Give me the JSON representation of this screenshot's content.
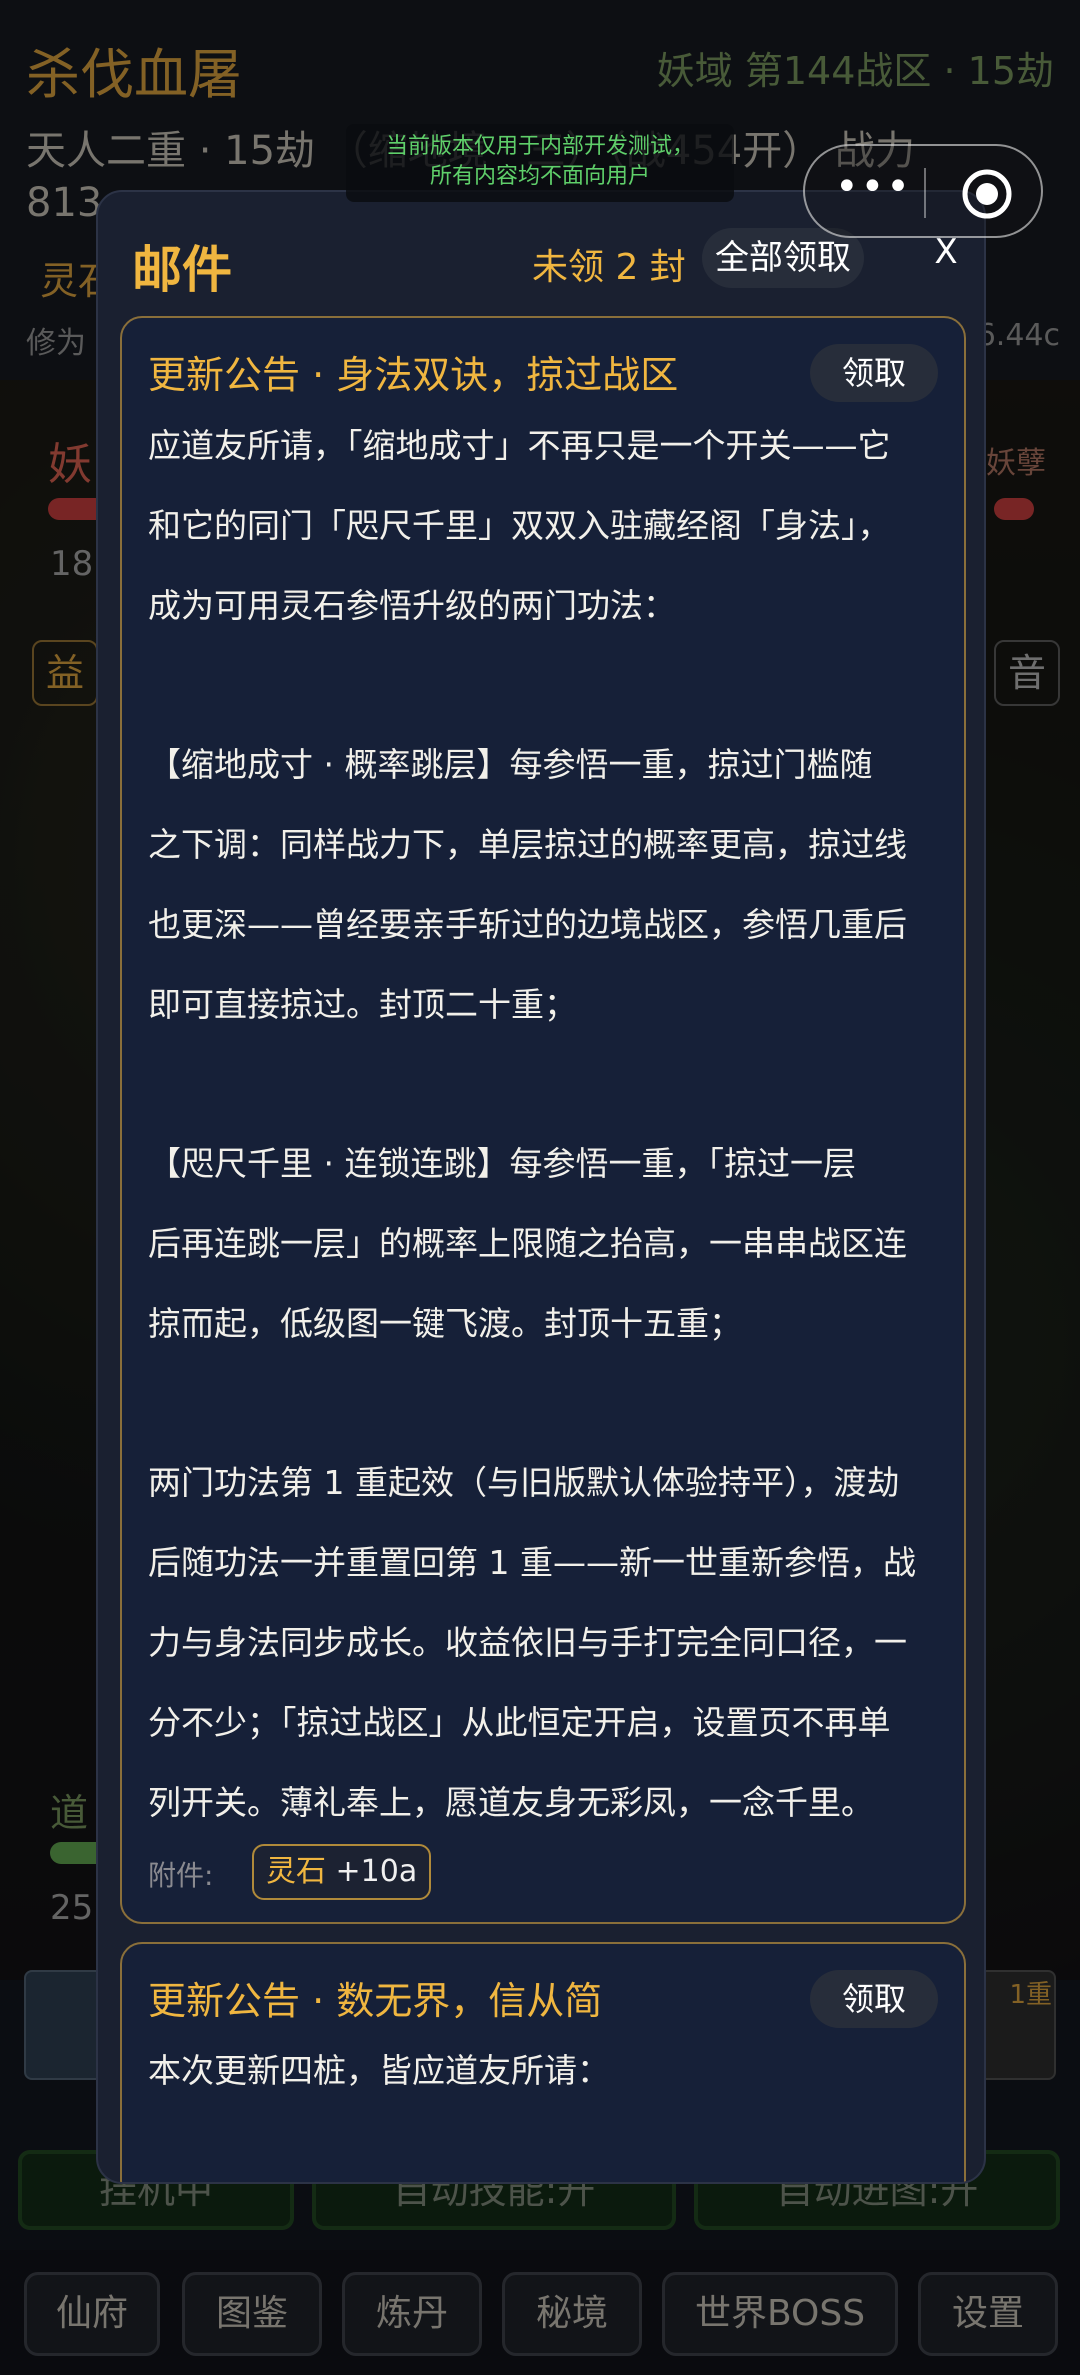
{
  "background": {
    "game_title": "杀伐血屠",
    "zone_info": "妖域 第144战区 · 15劫",
    "realm_line": "天人二重 · 15劫 （缩地境 · 三）（战454开） 战力",
    "realm_line2": "813",
    "lingshi_tag": "灵石",
    "xiuwei_label": "修为",
    "speed_value": "6.44c",
    "enemy_name": "妖",
    "enemy_right": "妖孽",
    "num_18": "18",
    "tag_yi": "益",
    "tag_yin": "音",
    "dao_label": "道",
    "num_25": "25",
    "level_badge": "1重",
    "controls": [
      "挂机中",
      "自动技能:开",
      "自动进图:开"
    ],
    "nav": [
      "仙府",
      "图鉴",
      "炼丹",
      "秘境",
      "世界BOSS",
      "设置"
    ]
  },
  "dev_notice": {
    "line1": "当前版本仅用于内部开发测试，",
    "line2": "所有内容均不面向用户"
  },
  "capsule": {
    "more_icon": "more-dots-icon",
    "target_icon": "target-icon"
  },
  "mail_modal": {
    "title": "邮件",
    "unclaimed": "未领 2 封",
    "claim_all": "全部领取",
    "close": "X",
    "mails": [
      {
        "title": "更新公告 · 身法双诀，掠过战区",
        "claim": "领取",
        "body": [
          "应道友所请，「缩地成寸」不再只是一个开关——它",
          "和它的同门「咫尺千里」双双入驻藏经阁「身法」，",
          "成为可用灵石参悟升级的两门功法：",
          "",
          "【缩地成寸 · 概率跳层】每参悟一重，掠过门槛随",
          "之下调：同样战力下，单层掠过的概率更高，掠过线",
          "也更深——曾经要亲手斩过的边境战区，参悟几重后",
          "即可直接掠过。封顶二十重；",
          "",
          "【咫尺千里 · 连锁连跳】每参悟一重，「掠过一层",
          "后再连跳一层」的概率上限随之抬高，一串串战区连",
          "掠而起，低级图一键飞渡。封顶十五重；",
          "",
          "两门功法第 1 重起效（与旧版默认体验持平），渡劫",
          "后随功法一并重置回第 1 重——新一世重新参悟，战",
          "力与身法同步成长。收益依旧与手打完全同口径，一",
          "分不少；「掠过战区」从此恒定开启，设置页不再单",
          "列开关。薄礼奉上，愿道友身无彩凤，一念千里。"
        ],
        "attachment_label": "附件:",
        "attachment_resource": "灵石",
        "attachment_amount": "+10a"
      },
      {
        "title": "更新公告 · 数无界，信从简",
        "claim": "领取",
        "body_first": "本次更新四桩，皆应道友所请："
      }
    ]
  }
}
